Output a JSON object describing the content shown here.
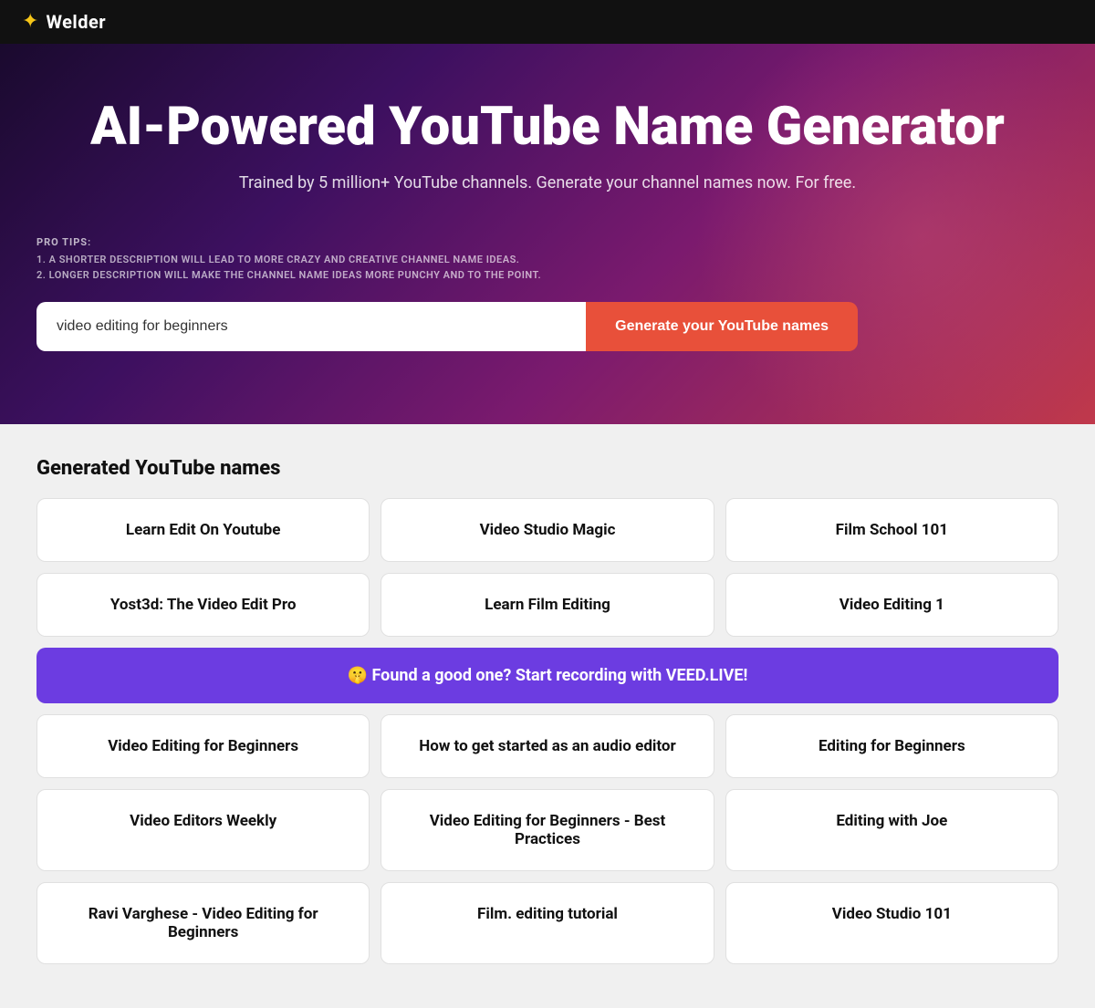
{
  "header": {
    "logo_icon": "✦",
    "logo_text": "Welder"
  },
  "hero": {
    "title": "AI-Powered YouTube Name Generator",
    "subtitle": "Trained by 5 million+ YouTube channels. Generate your channel names now. For free.",
    "pro_tips_label": "PRO TIPS:",
    "pro_tip_1": "1. A SHORTER DESCRIPTION WILL LEAD TO MORE CRAZY AND CREATIVE CHANNEL NAME IDEAS.",
    "pro_tip_2": "2. LONGER DESCRIPTION WILL MAKE THE CHANNEL NAME IDEAS MORE PUNCHY AND TO THE POINT.",
    "search_placeholder": "video editing for beginners",
    "search_value": "video editing for beginners",
    "generate_btn_label": "Generate your YouTube names"
  },
  "results": {
    "section_title": "Generated YouTube names",
    "cta_text": "🤫 Found a good one? Start recording with VEED.LIVE!",
    "names": [
      "Learn Edit On Youtube",
      "Video Studio Magic",
      "Film School 101",
      "Yost3d: The Video Edit Pro",
      "Learn Film Editing",
      "Video Editing 1",
      "Video Editing for Beginners",
      "How to get started as an audio editor",
      "Editing for Beginners",
      "Video Editors Weekly",
      "Video Editing for Beginners - Best Practices",
      "Editing with Joe",
      "Ravi Varghese - Video Editing for Beginners",
      "Film. editing tutorial",
      "Video Studio 101"
    ]
  }
}
